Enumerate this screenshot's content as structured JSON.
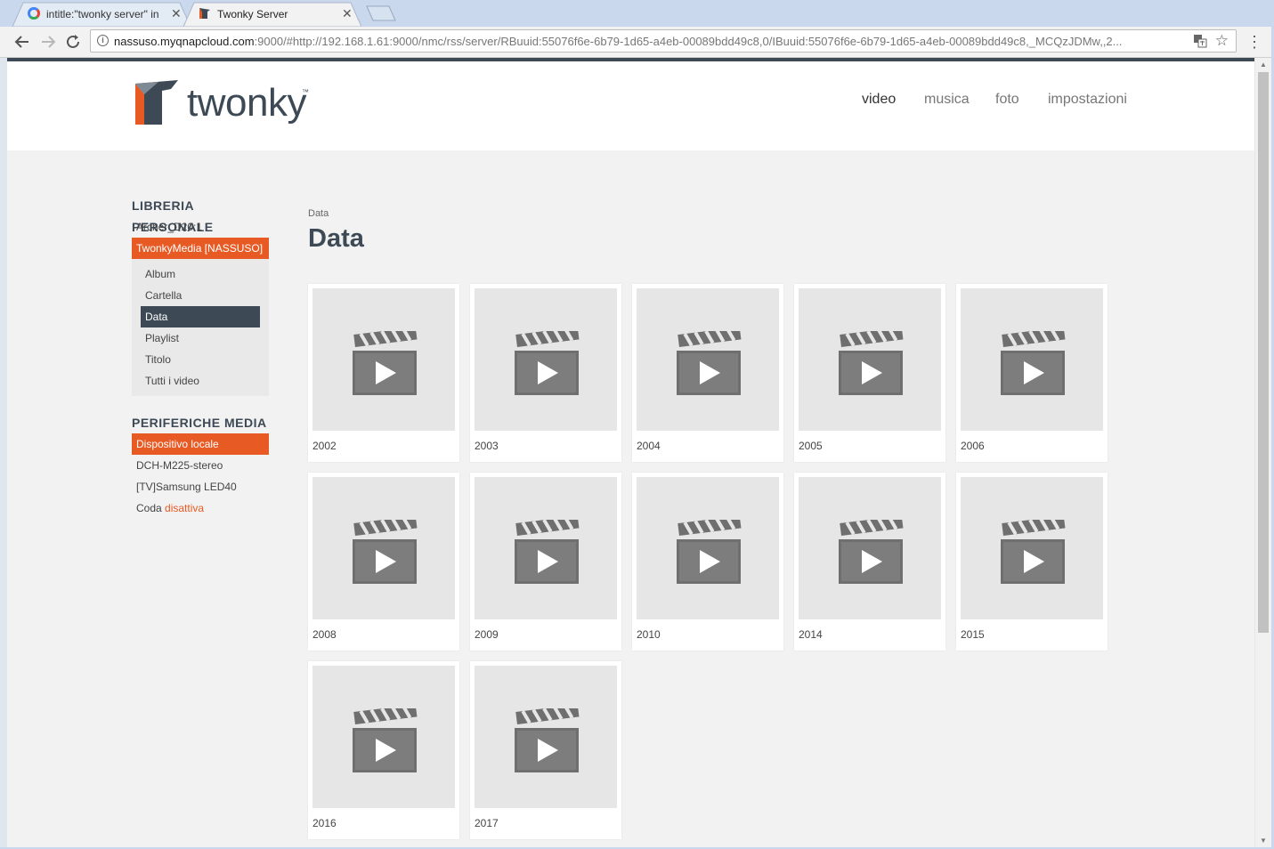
{
  "browser": {
    "tabs": [
      {
        "title": "intitle:\"twonky server\" in",
        "favicon": "google-icon",
        "active": false
      },
      {
        "title": "Twonky Server",
        "favicon": "twonky-icon",
        "active": true
      }
    ],
    "url_host": "nassuso.myqnapcloud.com",
    "url_rest": ":9000/#http://192.168.1.61:9000/nmc/rss/server/RBuuid:55076f6e-6b79-1d65-a4eb-00089bdd49c8,0/IBuuid:55076f6e-6b79-1d65-a4eb-00089bdd49c8,_MCQzJDMw,,2..."
  },
  "header": {
    "logo_text": "twonky",
    "logo_tm": "™",
    "nav": [
      {
        "label": "video",
        "active": true
      },
      {
        "label": "musica",
        "active": false
      },
      {
        "label": "foto",
        "active": false
      },
      {
        "label": "impostazioni",
        "active": false
      }
    ]
  },
  "sidebar": {
    "library_heading": "LIBRERIA PERSONALE",
    "library_items": [
      "Archer_D20:1",
      "TwonkyMedia [NASSUSO]"
    ],
    "selected_library": "TwonkyMedia [NASSUSO]",
    "sub_items": [
      "Album",
      "Cartella",
      "Data",
      "Playlist",
      "Titolo",
      "Tutti i video"
    ],
    "active_sub_item": "Data",
    "devices_heading": "PERIFERICHE MEDIA",
    "device_items": [
      "Dispositivo locale",
      "DCH-M225-stereo",
      "[TV]Samsung LED40"
    ],
    "selected_device": "Dispositivo locale",
    "queue_label": "Coda",
    "queue_state": "disattiva"
  },
  "main": {
    "breadcrumb": "Data",
    "title": "Data",
    "items": [
      "2002",
      "2003",
      "2004",
      "2005",
      "2006",
      "2008",
      "2009",
      "2010",
      "2014",
      "2015",
      "2016",
      "2017"
    ]
  },
  "colors": {
    "accent": "#e85a24",
    "dark": "#3d4a55",
    "background": "#f2f2f2"
  }
}
